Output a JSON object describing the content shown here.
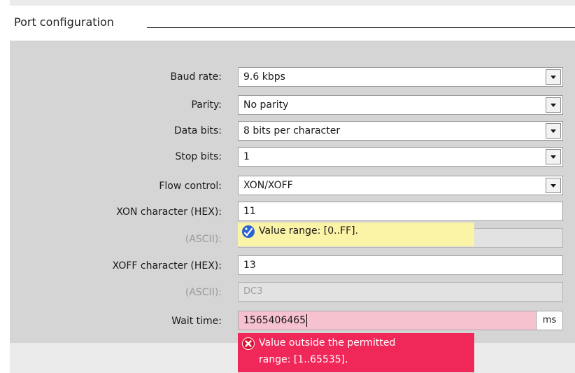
{
  "section": {
    "title": "Port configuration"
  },
  "fields": {
    "baud_rate": {
      "label": "Baud rate:",
      "value": "9.6 kbps"
    },
    "parity": {
      "label": "Parity:",
      "value": "No parity"
    },
    "data_bits": {
      "label": "Data bits:",
      "value": "8 bits per character"
    },
    "stop_bits": {
      "label": "Stop bits:",
      "value": "1"
    },
    "flow_control": {
      "label": "Flow control:",
      "value": "XON/XOFF"
    },
    "xon_hex": {
      "label": "XON character (HEX):",
      "value": "11"
    },
    "xon_ascii": {
      "label": "(ASCII):",
      "value": ""
    },
    "xoff_hex": {
      "label": "XOFF character (HEX):",
      "value": "13"
    },
    "xoff_ascii": {
      "label": "(ASCII):",
      "value": "DC3"
    },
    "wait_time": {
      "label": "Wait time:",
      "value": "1565406465",
      "unit": "ms"
    }
  },
  "tooltips": {
    "info": "Value range: [0..FF].",
    "error_line1": "Value outside the permitted",
    "error_line2": "range: [1..65535]."
  },
  "colors": {
    "info_bg": "#fbf3a6",
    "error_bg": "#f0285a",
    "error_field_bg": "#f7c2cf",
    "form_bg": "#d5d5d5"
  }
}
